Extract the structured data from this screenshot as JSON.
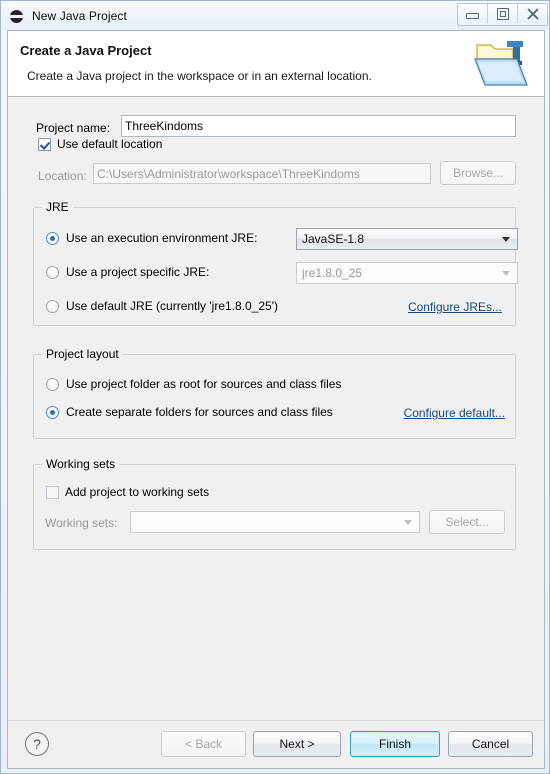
{
  "window": {
    "title": "New Java Project",
    "icon": "eclipse-icon",
    "controls": {
      "minimize": "minimize-icon",
      "maximize": "maximize-icon",
      "close": "close-icon"
    }
  },
  "banner": {
    "title": "Create a Java Project",
    "description": "Create a Java project in the workspace or in an external location.",
    "icon": "java-project-folder-icon"
  },
  "project": {
    "name_label": "Project name:",
    "name_value": "ThreeKindoms",
    "use_default_location_label": "Use default location",
    "use_default_location_checked": true,
    "location_label": "Location:",
    "location_value": "C:\\Users\\Administrator\\workspace\\ThreeKindoms",
    "browse_label": "Browse..."
  },
  "jre": {
    "group_title": "JRE",
    "option_execution_env": "Use an execution environment JRE:",
    "execution_env_value": "JavaSE-1.8",
    "option_project_specific": "Use a project specific JRE:",
    "project_specific_value": "jre1.8.0_25",
    "option_default_jre": "Use default JRE (currently 'jre1.8.0_25')",
    "selected": "execution_env",
    "configure_link": "Configure JREs..."
  },
  "layout": {
    "group_title": "Project layout",
    "option_project_folder": "Use project folder as root for sources and class files",
    "option_separate_folders": "Create separate folders for sources and class files",
    "selected": "separate_folders",
    "configure_link": "Configure default..."
  },
  "working_sets": {
    "group_title": "Working sets",
    "add_label": "Add project to working sets",
    "add_checked": false,
    "sets_label": "Working sets:",
    "sets_value": "",
    "select_label": "Select..."
  },
  "buttons": {
    "help": "?",
    "back": "< Back",
    "next": "Next >",
    "finish": "Finish",
    "cancel": "Cancel"
  },
  "colors": {
    "accent": "#3f9fc4",
    "link": "#1b4a7a",
    "dialog_bg": "#f0f0f0",
    "banner_bg": "#ffffff"
  }
}
